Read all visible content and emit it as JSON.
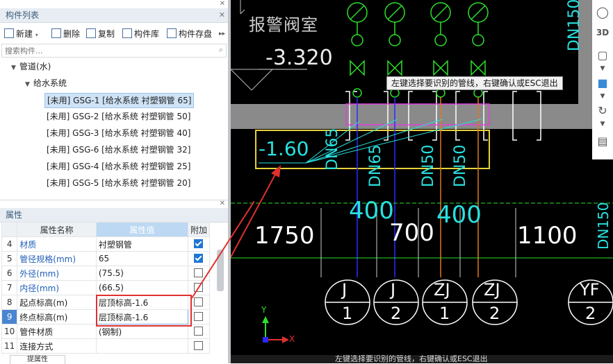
{
  "component_panel": {
    "title": "构件列表",
    "toolbar": {
      "new": "新建",
      "delete": "删除",
      "copy": "复制",
      "library": "构件库",
      "store": "构件存盘"
    },
    "search_placeholder": "搜索构件...",
    "tree": {
      "root": "管道(水)",
      "child": "给水系统",
      "items": [
        "[未用] GSG-1 [给水系统 衬塑钢管 65]",
        "[未用] GSG-2 [给水系统 衬塑钢管 50]",
        "[未用] GSG-3 [给水系统 衬塑钢管 40]",
        "[未用] GSG-6 [给水系统 衬塑钢管 32]",
        "[未用] GSG-4 [给水系统 衬塑钢管 25]",
        "[未用] GSG-5 [给水系统 衬塑钢管 20]"
      ],
      "selected_index": 0
    }
  },
  "property_panel": {
    "title": "属性",
    "headers": {
      "name": "属性名称",
      "value": "属性值",
      "extra": "附加"
    },
    "rows": [
      {
        "num": "4",
        "name": "材质",
        "value": "衬塑钢管",
        "checked": true,
        "blue": true
      },
      {
        "num": "5",
        "name": "管径规格(mm)",
        "value": "65",
        "checked": true,
        "blue": true
      },
      {
        "num": "6",
        "name": "外径(mm)",
        "value": "(75.5)",
        "checked": false,
        "blue": true
      },
      {
        "num": "7",
        "name": "内径(mm)",
        "value": "(66.5)",
        "checked": false,
        "blue": true
      },
      {
        "num": "8",
        "name": "起点标高(m)",
        "value": "层顶标高-1.6",
        "checked": false,
        "blue": false
      },
      {
        "num": "9",
        "name": "终点标高(m)",
        "value": "层顶标高-1.6",
        "checked": false,
        "blue": false
      },
      {
        "num": "10",
        "name": "管件材质",
        "value": "(钢制)",
        "checked": false,
        "blue": false
      },
      {
        "num": "11",
        "name": "连接方式",
        "value": "",
        "checked": false,
        "blue": false
      }
    ],
    "bottom_tab": "提属性"
  },
  "cad": {
    "room_label": "报警阀室",
    "elevation": "-3.320",
    "pipe_elev": "-1.60",
    "dn_labels": [
      "DN65",
      "DN65",
      "DN50",
      "DN50"
    ],
    "dn150": "DN150",
    "dims": [
      "400",
      "400",
      "1750",
      "700",
      "1100"
    ],
    "axis_labels": [
      {
        "top": "J",
        "bottom": "1"
      },
      {
        "top": "J",
        "bottom": "2"
      },
      {
        "top": "ZJ",
        "bottom": "1"
      },
      {
        "top": "ZJ",
        "bottom": "2"
      },
      {
        "top": "YF",
        "bottom": "2"
      }
    ],
    "edge_text": "-1",
    "x_axis": "X",
    "y_axis": "Y"
  },
  "tooltip": "左键选择要识别的管线，右键确认或ESC退出",
  "status_text": "左键选择要识别的管线，右键确认或ESC退出",
  "colors": {
    "cad_bg": "#000000",
    "highlight": "#e8d23a",
    "arrow": "#e03030"
  }
}
